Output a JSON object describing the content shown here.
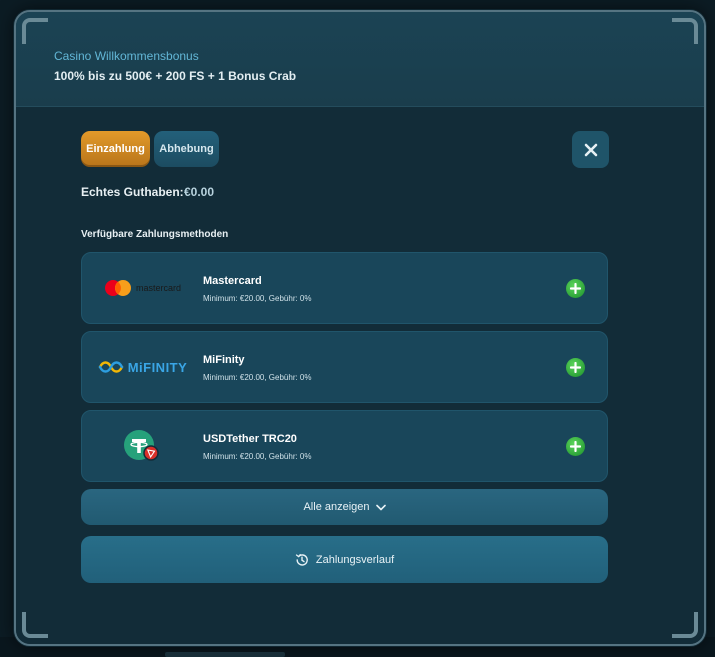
{
  "bonus": {
    "label": "Casino Willkommensbonus",
    "text": "100% bis zu 500€ + 200 FS + 1 Bonus Crab"
  },
  "tabs": {
    "deposit": "Einzahlung",
    "withdraw": "Abhebung"
  },
  "balance": {
    "label": "Echtes Guthaben:",
    "value": "€0.00"
  },
  "methods_title": "Verfügbare Zahlungsmethoden",
  "methods": [
    {
      "name": "Mastercard",
      "meta": "Minimum: €20.00, Gebühr: 0%",
      "logo_text": "mastercard",
      "icon": "mastercard-logo"
    },
    {
      "name": "MiFinity",
      "meta": "Minimum: €20.00, Gebühr: 0%",
      "logo_text": "MiFINITY",
      "icon": "mifinity-logo"
    },
    {
      "name": "USDTether TRC20",
      "meta": "Minimum: €20.00, Gebühr: 0%",
      "logo_text": "",
      "icon": "tether-logo"
    }
  ],
  "show_all_label": "Alle anzeigen",
  "history_label": "Zahlungsverlauf",
  "colors": {
    "deposit_tab": "#e29a2a",
    "accent_blue": "#62b6d6",
    "add_green": "#2ea43a",
    "tether_green": "#26a17b",
    "tron_red": "#d9302a"
  }
}
